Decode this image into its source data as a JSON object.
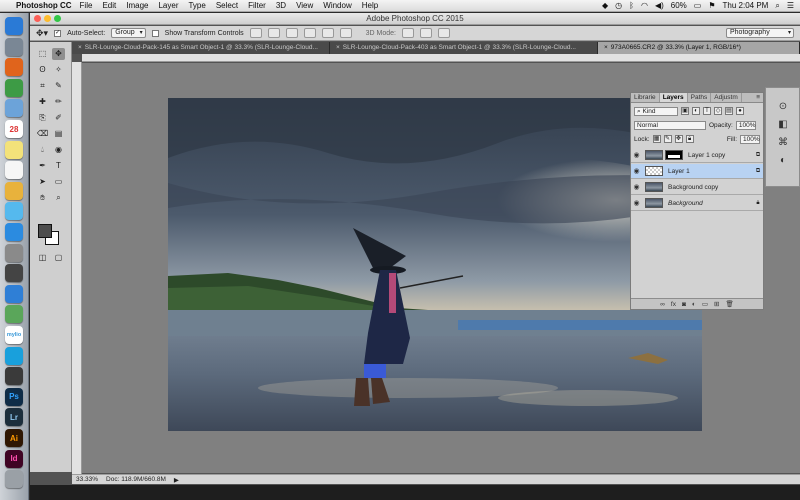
{
  "menubar": {
    "app_name": "Photoshop CC",
    "items": [
      "File",
      "Edit",
      "Image",
      "Layer",
      "Type",
      "Select",
      "Filter",
      "3D",
      "View",
      "Window",
      "Help"
    ],
    "battery": "60%",
    "clock": "Thu 2:04 PM"
  },
  "window": {
    "title": "Adobe Photoshop CC 2015"
  },
  "options_bar": {
    "auto_select_label": "Auto-Select:",
    "auto_select_value": "Group",
    "transform_label": "Show Transform Controls",
    "mode_3d_label": "3D Mode:",
    "workspace": "Photography"
  },
  "tabs": [
    {
      "label": "SLR-Lounge-Cloud-Pack-145 as Smart Object-1 @ 33.3% (SLR-Lounge-Cloud...",
      "active": false
    },
    {
      "label": "SLR-Lounge-Cloud-Pack-403 as Smart Object-1 @ 33.3% (SLR-Lounge-Cloud...",
      "active": false
    },
    {
      "label": "973A0665.CR2 @ 33.3% (Layer 1, RGB/16*)",
      "active": true
    }
  ],
  "status": {
    "zoom": "33.33%",
    "doc": "Doc: 118.9M/660.8M"
  },
  "layers_panel": {
    "tabs": [
      "Librarie",
      "Layers",
      "Paths",
      "Adjustm"
    ],
    "filter_kind": "Kind",
    "blend_mode": "Normal",
    "opacity_label": "Opacity:",
    "opacity_value": "100%",
    "lock_label": "Lock:",
    "fill_label": "Fill:",
    "fill_value": "100%",
    "layers": [
      {
        "name": "Layer 1 copy",
        "selected": false,
        "italic": false
      },
      {
        "name": "Layer 1",
        "selected": true,
        "italic": false
      },
      {
        "name": "Background copy",
        "selected": false,
        "italic": false
      },
      {
        "name": "Background",
        "selected": false,
        "italic": true
      }
    ],
    "footer_icons": [
      "link-icon",
      "fx-icon",
      "mask-icon",
      "adjustment-icon",
      "folder-icon",
      "new-layer-icon",
      "trash-icon"
    ]
  },
  "dock_apps": [
    {
      "name": "Finder",
      "color": "#2a7ad6"
    },
    {
      "name": "Launchpad",
      "color": "#7a8795"
    },
    {
      "name": "Firefox",
      "color": "#e0641c"
    },
    {
      "name": "Chrome",
      "color": "#3d9b45"
    },
    {
      "name": "Mail",
      "color": "#6ca3d9"
    },
    {
      "name": "Calendar",
      "color": "#ffffff"
    },
    {
      "name": "Notes",
      "color": "#f3e27a"
    },
    {
      "name": "Reminders",
      "color": "#f6f6f6"
    },
    {
      "name": "Photos",
      "color": "#e8b23c"
    },
    {
      "name": "Messages",
      "color": "#55b9ee"
    },
    {
      "name": "App Store",
      "color": "#2b8be0"
    },
    {
      "name": "Preferences",
      "color": "#8a8a8a"
    },
    {
      "name": "Camera",
      "color": "#444444"
    },
    {
      "name": "Safari",
      "color": "#2f7fd6"
    },
    {
      "name": "Maps",
      "color": "#5aa65a"
    },
    {
      "name": "mylio",
      "color": "#ffffff"
    },
    {
      "name": "Skype",
      "color": "#19a0dc"
    },
    {
      "name": "Bridge",
      "color": "#3a3a3a"
    },
    {
      "name": "Ps",
      "color": "#0f2c47"
    },
    {
      "name": "Lr",
      "color": "#1c2e3c"
    },
    {
      "name": "Ai",
      "color": "#2f1703"
    },
    {
      "name": "Id",
      "color": "#3f0424"
    },
    {
      "name": "Trash",
      "color": "#9aa0a6"
    }
  ]
}
